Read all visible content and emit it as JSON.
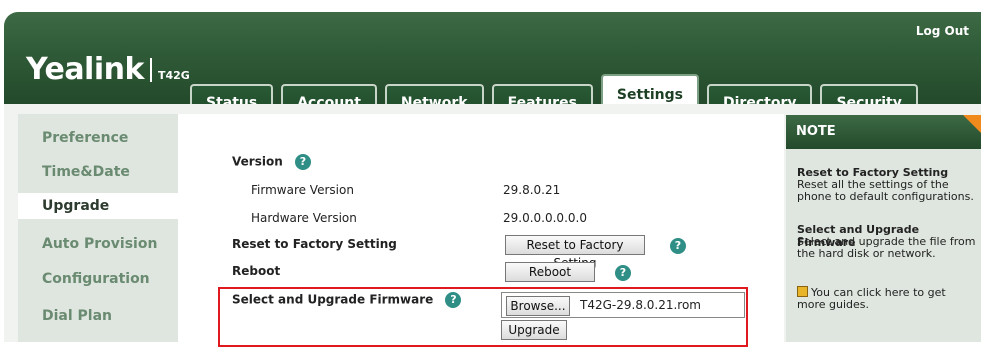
{
  "header": {
    "logout": "Log Out",
    "logo": "Yealink",
    "model": "T42G"
  },
  "tabs": [
    "Status",
    "Account",
    "Network",
    "Features",
    "Settings",
    "Directory",
    "Security"
  ],
  "active_tab": "Settings",
  "sidebar": {
    "items": [
      "Preference",
      "Time&Date",
      "Upgrade",
      "Auto Provision",
      "Configuration",
      "Dial Plan"
    ],
    "active": "Upgrade"
  },
  "content": {
    "version_label": "Version",
    "firmware_label": "Firmware Version",
    "firmware_value": "29.8.0.21",
    "hardware_label": "Hardware Version",
    "hardware_value": "29.0.0.0.0.0.0",
    "reset_label": "Reset to Factory Setting",
    "reset_button": "Reset to Factory Setting",
    "reboot_label": "Reboot",
    "reboot_button": "Reboot",
    "upgrade_label": "Select and Upgrade Firmware",
    "browse_button": "Browse...",
    "file_name": "T42G-29.8.0.21.rom",
    "upgrade_button": "Upgrade",
    "help_glyph": "?"
  },
  "note": {
    "title": "NOTE",
    "reset_title": "Reset to Factory Setting",
    "reset_text": "Reset all the settings of the phone to default configurations.",
    "upgrade_title": "Select and Upgrade Firmware",
    "upgrade_text": "Select and upgrade the file from the hard disk or network.",
    "guide_text": "You can click here to get more guides."
  },
  "colors": {
    "header_green": "#2f5a37",
    "highlight_red": "#e0191f",
    "help_teal": "#2f8f86",
    "note_corner": "#f08a1c"
  }
}
